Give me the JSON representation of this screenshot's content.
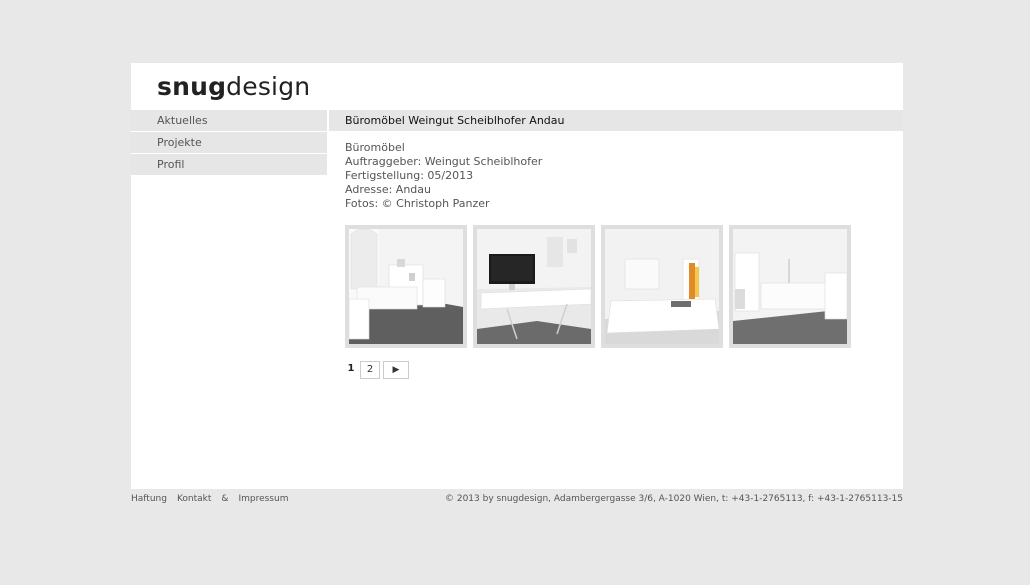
{
  "brand": {
    "logo_bold": "snug",
    "logo_light": "design"
  },
  "nav": {
    "items": [
      {
        "label": "Aktuelles"
      },
      {
        "label": "Projekte"
      },
      {
        "label": "Profil"
      }
    ]
  },
  "project": {
    "title": "Büromöbel Weingut Scheiblhofer Andau",
    "details": [
      "Büromöbel",
      "Auftraggeber: Weingut Scheiblhofer",
      "Fertigstellung: 05/2013",
      "Adresse: Andau",
      "Fotos: © Christoph Panzer"
    ]
  },
  "pager": {
    "pages": [
      "1",
      "2"
    ],
    "next_symbol": "▶"
  },
  "footer": {
    "links": [
      "Haftung",
      "Kontakt",
      "&",
      "Impressum"
    ],
    "copyright": "© 2013 by snugdesign, Adambergergasse 3/6, A-1020 Wien, t: +43-1-2765113, f: +43-1-2765113-15"
  }
}
